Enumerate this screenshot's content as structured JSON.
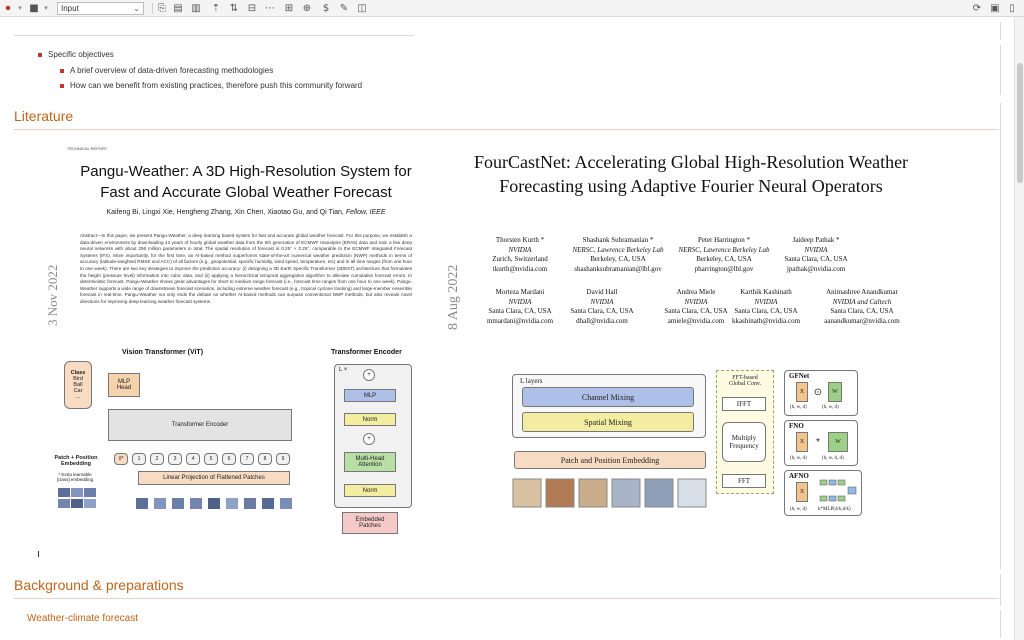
{
  "toolbar": {
    "cell_type": "Input",
    "icons": [
      "record-icon",
      "stop-icon",
      "chevron-down-icon",
      "cell-type-select",
      "cut-icon",
      "copy-icon",
      "paste-icon",
      "move-up-icon",
      "move-down-icon",
      "delete-icon",
      "ruler-icon",
      "split-icon",
      "merge-icon",
      "pen-icon",
      "format-icon",
      "sync-icon",
      "panel-icon",
      "page-icon"
    ]
  },
  "outline": {
    "specific_objectives": "Specific objectives",
    "bullets": [
      "A brief overview of data-driven forecasting methodologies",
      "How can we benefit from existing practices, therefore push this community forward"
    ],
    "literature": "Literature",
    "background": "Background & preparations",
    "weather_climate": "Weather-climate forecast"
  },
  "paper1": {
    "label": "TECHNICAL REPORT",
    "title": "Pangu-Weather: A 3D High-Resolution System for Fast and Accurate Global Weather Forecast",
    "authors": "Kaifeng Bi, Lingxi Xie, Hengheng Zhang, Xin Chen, Xiaotao Gu, and Qi Tian",
    "authors_suffix": "Fellow, IEEE",
    "date": "3 Nov 2022",
    "abstract": "Abstract—In this paper, we present Pangu-Weather, a deep learning based system for fast and accurate global weather forecast. For this purpose, we establish a data-driven environment by downloading 43 years of hourly global weather data from the 5th generation of ECMWF reanalysis (ERA5) data and train a few deep neural networks with about 256 million parameters in total. The spatial resolution of forecast is 0.25° × 0.25°, comparable to the ECMWF Integrated Forecast Systems (IFS). More importantly, for the first time, an AI-based method outperforms state-of-the-art numerical weather prediction (NWP) methods in terms of accuracy (latitude-weighted RMSE and ACC) of all factors (e.g., geopotential, specific humidity, wind speed, temperature, etc) and in all time ranges (from one hour to one week). There are two key strategies to improve the prediction accuracy: (i) designing a 3D Earth Specific Transformer (3DEST) architecture that formulates the height (pressure level) information into cubic data, and (ii) applying a hierarchical temporal aggregation algorithm to alleviate cumulative forecast errors. In deterministic forecast, Pangu-Weather shows great advantages for short to medium-range forecast (i.e., forecast time ranges from one hour to one week). Pangu-Weather supports a wide range of downstream forecast scenarios, including extreme weather forecast (e.g., tropical cyclone tracking) and large-member ensemble forecast in real-time. Pangu-Weather not only ends the debate on whether AI-based methods can surpass conventional NWP methods, but also reveals novel directions for improving deep learning weather forecast systems.",
    "vit": {
      "title": "Vision Transformer (ViT)",
      "class_box": [
        "Class",
        "Bird",
        "Ball",
        "Car",
        "..."
      ],
      "mlp_head": [
        "MLP",
        "Head"
      ],
      "encoder": "Transformer Encoder",
      "patch_embed": [
        "Patch + Position",
        "Embedding"
      ],
      "extra": [
        "* Extra learnable",
        "[class] embedding"
      ],
      "linear": "Linear Projection of Flattened Patches",
      "tokens": [
        "0*",
        "1",
        "2",
        "3",
        "4",
        "5",
        "6",
        "7",
        "8",
        "9"
      ]
    },
    "encoder_fig": {
      "title": "Transformer Encoder",
      "lx": "L ×",
      "mlp": "MLP",
      "norm1": "Norm",
      "mha": [
        "Multi-Head",
        "Attention"
      ],
      "norm2": "Norm",
      "embedded": [
        "Embedded",
        "Patches"
      ]
    }
  },
  "paper2": {
    "title": "FourCastNet: Accelerating Global High-Resolution Weather Forecasting using Adaptive Fourier Neural Operators",
    "date": "8 Aug 2022",
    "authors": [
      {
        "name": "Thorsten Kurth",
        "sup": "*",
        "aff": "NVIDIA",
        "loc": "Zurich, Switzerland",
        "email": "tkurth@nvidia.com"
      },
      {
        "name": "Shashank Subramanian",
        "sup": "*",
        "aff": "NERSC, Lawrence Berkeley Lab",
        "loc": "Berkeley, CA, USA",
        "email": "shashanksubramanian@lbl.gov"
      },
      {
        "name": "Peter Harrington",
        "sup": "*",
        "aff": "NERSC, Lawrence Berkeley Lab",
        "loc": "Berkeley, CA, USA",
        "email": "pharrington@lbl.gov"
      },
      {
        "name": "Jaideep Pathak",
        "sup": "*",
        "aff": "NVIDIA",
        "loc": "Santa Clara, CA, USA",
        "email": "jpathak@nvidia.com"
      },
      {
        "name": "Morteza Mardani",
        "sup": "",
        "aff": "NVIDIA",
        "loc": "Santa Clara, CA, USA",
        "email": "mmardani@nvidia.com"
      },
      {
        "name": "David Hall",
        "sup": "",
        "aff": "NVIDIA",
        "loc": "Santa Clara, CA, USA",
        "email": "dhall@nvidia.com"
      },
      {
        "name": "Andrea Miele",
        "sup": "",
        "aff": "NVIDIA",
        "loc": "Santa Clara, CA, USA",
        "email": "amiele@nvidia.com"
      },
      {
        "name": "Karthik Kashinath",
        "sup": "",
        "aff": "NVIDIA",
        "loc": "Santa Clara, CA, USA",
        "email": "kkashinath@nvidia.com"
      },
      {
        "name": "Animashree Anandkumar",
        "sup": "",
        "aff": "NVIDIA and Caltech",
        "loc": "Santa Clara, CA, USA",
        "email": "aanandkumar@nvidia.com"
      }
    ],
    "fig": {
      "l_layers": "L layers",
      "channel_mixing": "Channel Mixing",
      "spatial_mixing": "Spatial Mixing",
      "patch_embedding": "Patch and Position Embedding",
      "fft_global": [
        "FFT-based",
        "Global Conv."
      ],
      "ifft": "IFFT",
      "multiply": [
        "Multiply",
        "Frequency"
      ],
      "fft": "FFT",
      "gfnet": "GFNet",
      "fno": "FNO",
      "afno": "AFNO",
      "xk": "X",
      "wk": "W",
      "dims1": [
        "(h, w, d)",
        "(h, w, d)"
      ],
      "dims2": [
        "(h, w, d)",
        "(h, w, d, d)"
      ],
      "dims3": [
        "(h, w, d)",
        "k*MLP(d/k,d/k)"
      ],
      "op_dot": "⊙",
      "op_star": "*"
    }
  },
  "colors": {
    "accent": "#c0651c",
    "bullet": "#c0392b",
    "channel": "#aebfe8",
    "spatial": "#f2eda0",
    "patch": "#f7dcc3"
  }
}
